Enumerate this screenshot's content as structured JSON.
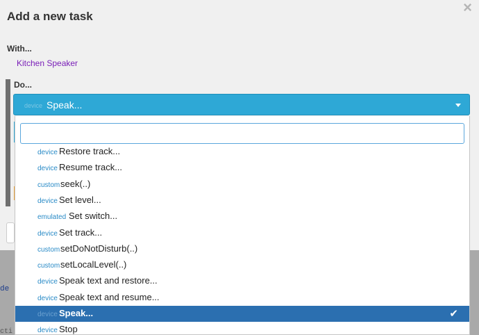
{
  "modal": {
    "title": "Add a new task",
    "close_glyph": "×",
    "with_label": "With...",
    "with_value": "Kitchen Speaker",
    "do_label": "Do..."
  },
  "select": {
    "tag": "device",
    "value": "Speak...",
    "caret": "chevron-down-icon"
  },
  "dropdown": {
    "search_value": "",
    "options": [
      {
        "tag": "device",
        "label": "Restore track..."
      },
      {
        "tag": "device",
        "label": "Resume track..."
      },
      {
        "tag": "custom",
        "label": "seek(..)"
      },
      {
        "tag": "device",
        "label": "Set level..."
      },
      {
        "tag": "emulated",
        "label": "Set switch..."
      },
      {
        "tag": "device",
        "label": "Set track..."
      },
      {
        "tag": "custom",
        "label": "setDoNotDisturb(..)"
      },
      {
        "tag": "custom",
        "label": "setLocalLevel(..)"
      },
      {
        "tag": "device",
        "label": "Speak text and restore..."
      },
      {
        "tag": "device",
        "label": "Speak text and resume..."
      },
      {
        "tag": "device",
        "label": "Speak...",
        "selected": true
      },
      {
        "tag": "device",
        "label": "Stop"
      }
    ],
    "check_glyph": "✔"
  },
  "background": {
    "code_fragment": "de",
    "code_fragment2": "cti"
  },
  "colors": {
    "accent": "#2ea8d6",
    "selected_row": "#2b6fb0",
    "device_name": "#7a1fb8"
  }
}
